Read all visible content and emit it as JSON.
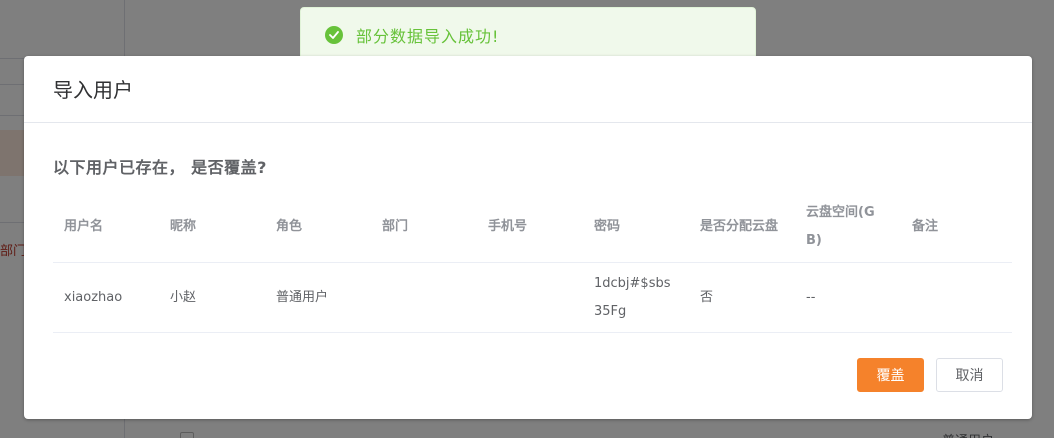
{
  "background": {
    "dept_fragment": "部门",
    "row_text": "··· ·· ··· ·· ·· ···· · ···· ·····",
    "row_role": "普通用户"
  },
  "toast": {
    "message": "部分数据导入成功!",
    "icon": "check-circle-icon",
    "color": "#67c23a"
  },
  "dialog": {
    "title": "导入用户",
    "question": "以下用户已存在， 是否覆盖?",
    "table": {
      "headers": [
        "用户名",
        "昵称",
        "角色",
        "部门",
        "手机号",
        "密码",
        "是否分配云盘",
        "云盘空间(GB)",
        "备注"
      ],
      "rows": [
        [
          "xiaozhao",
          "小赵",
          "普通用户",
          "",
          "",
          "1dcbj#$sbs35Fg",
          "否",
          "--",
          ""
        ]
      ]
    },
    "buttons": {
      "confirm": "覆盖",
      "cancel": "取消"
    },
    "accent_color": "#f5822b"
  }
}
